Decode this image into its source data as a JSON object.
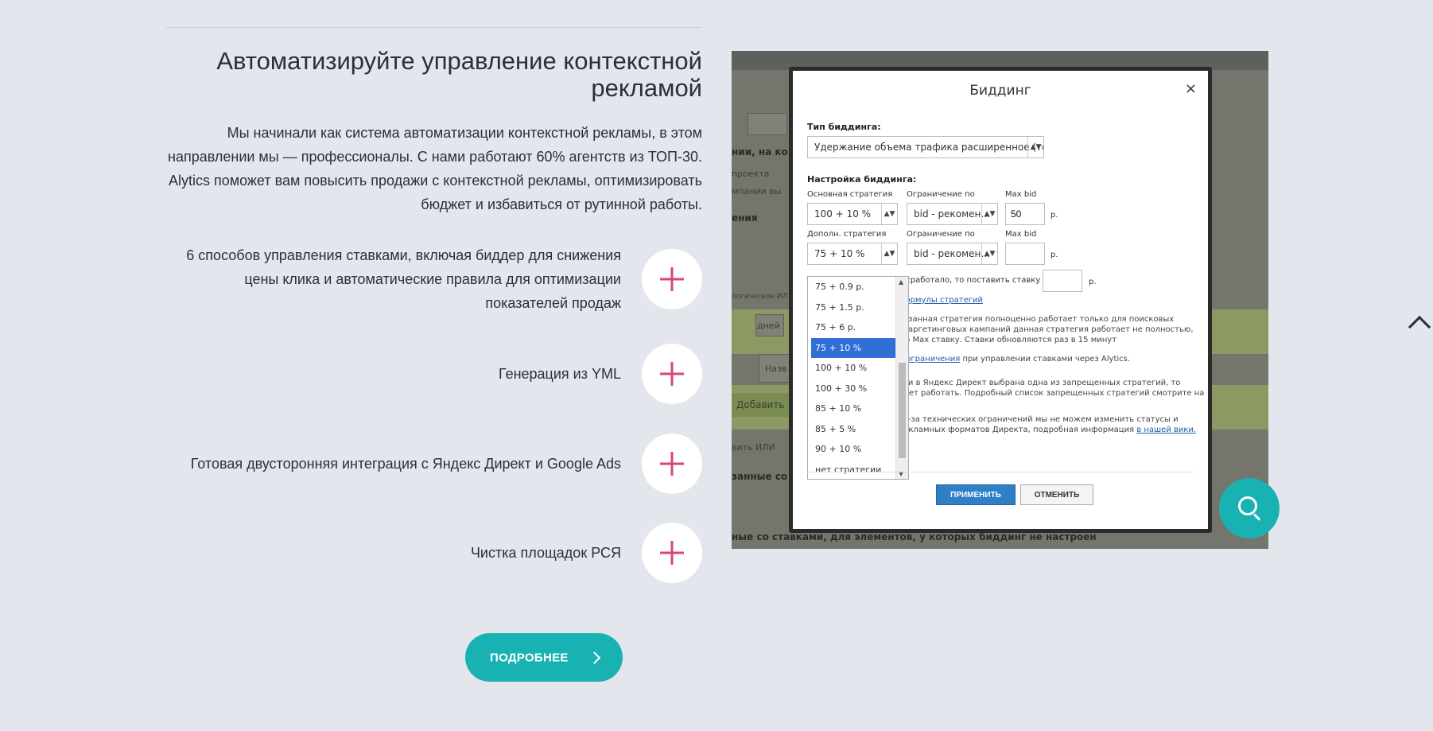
{
  "section": {
    "title": "Автоматизируйте управление контекстной рекламой",
    "lead": "Мы начинали как система автоматизации контекстной рекламы, в этом направлении мы — профессионалы. С нами работают 60% агентств из ТОП-30. Alytics поможет вам повысить продажи с контекстной рекламы, оптимизировать бюджет и избавиться от рутинной работы.",
    "features": [
      "6 способов управления ставками, включая биддер для снижения цены клика и автоматические правила для оптимизации показателей продаж",
      "Генерация из YML",
      "Готовая двусторонняя интеграция с Яндекс Директ и Google Ads",
      "Чистка площадок РСЯ"
    ],
    "more_label": "ПОДРОБНЕЕ"
  },
  "modal": {
    "title": "Биддинг",
    "close_glyph": "×",
    "bid_type_label": "Тип биддинга:",
    "bid_type_value": "Удержание объема трафика расширенное (тольк…",
    "settings_label": "Настройка биддинга:",
    "main_strategy_label": "Основная стратегия",
    "main_strategy_value": "100 + 10 %",
    "limit_label": "Ограничение по",
    "limit_value": "bid - рекомен…",
    "maxbid_label": "Max bid",
    "maxbid_value": "50",
    "unit": "р.",
    "extra_strategy_label": "Дополн. стратегия",
    "extra_strategy_value": "75 + 10 %",
    "limit2_label": "Ограничение по",
    "limit2_value": "bid - рекомен…",
    "maxbid2_label": "Max bid",
    "fallback_text": "е сработало, то поставить ставку равную:",
    "formula_link": "формулы стратегий",
    "para1_line1": "казанная стратегия полноценно работает только для поисковых",
    "para1_line2": "етаргетинговых кампаний данная стратегия работает не полностью,",
    "para1_line3": "ую Max ставку. Ставки обновляются раз в 15 минут",
    "para2_pre": "а ",
    "para2_link": "ограничения",
    "para2_post": " при управлении ставками через Alytics.",
    "para3_line1": "сли в Яндекс Директ выбрана одна из запрещенных стратегий, то",
    "para3_line2": "удет работать. Подробный список запрещенных стратегий смотрите на",
    "para4_line1": "из-за технических ограничений мы не можем изменить статусы и",
    "para4_line2_pre": "рекламных форматов Директа, подробная информация ",
    "para4_link": "в нашей вики.",
    "apply_label": "ПРИМЕНИТЬ",
    "cancel_label": "ОТМЕНИТЬ",
    "dropdown_options": [
      "75 + 0.9 р.",
      "75 + 1.5 р.",
      "75 + 6 р.",
      "75 + 10 %",
      "100 + 10 %",
      "100 + 30 %",
      "85 + 10 %",
      "85 + 5 %",
      "90 + 10 %",
      "нет стратегии"
    ],
    "dropdown_selected": "75 + 10 %"
  },
  "background_app": {
    "text1": "нии, на ко",
    "text2": "проекта",
    "text3": "мпании вы",
    "text4": "ения",
    "text5": "логическое ИЛ",
    "text6": "дней",
    "text7": "Назв",
    "text8": "Добавить",
    "text9": "вить ИЛИ",
    "text10": "занные со",
    "text11": "ные со ставками, для элементов, у которых биддинг не настроен"
  },
  "colors": {
    "accent": "#19b2b3",
    "plus": "#d6467e",
    "background": "#e3e6ed"
  }
}
